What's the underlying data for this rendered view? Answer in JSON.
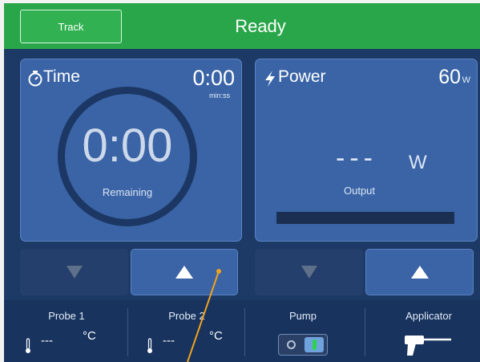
{
  "header": {
    "track_label": "Track",
    "status": "Ready",
    "color": "#2aa64a"
  },
  "time_panel": {
    "title": "Time",
    "icon": "stopwatch-icon",
    "value": "0:00",
    "unit": "min:ss",
    "big_value": "0:00",
    "sub_label": "Remaining"
  },
  "power_panel": {
    "title": "Power",
    "icon": "lightning-bolt-icon",
    "value": "60",
    "unit": "W",
    "output_value": "---",
    "output_unit": "W",
    "output_label": "Output",
    "output_level": 0
  },
  "controls": {
    "time_down_icon": "down-triangle-icon",
    "time_up_icon": "up-triangle-icon",
    "power_down_icon": "down-triangle-icon",
    "power_up_icon": "up-triangle-icon"
  },
  "bottom": {
    "probe1_label": "Probe 1",
    "probe1_value": "---",
    "probe1_unit": "°C",
    "probe2_label": "Probe 2",
    "probe2_value": "---",
    "probe2_unit": "°C",
    "pump_label": "Pump",
    "pump_state": "on",
    "applicator_label": "Applicator"
  },
  "colors": {
    "screen_bg": "#1d3a66",
    "panel_bg": "#3a64a6",
    "accent_blue": "#6fa3e0",
    "pump_led": "#2fd14a",
    "annotation_line": "#f2a31b"
  }
}
